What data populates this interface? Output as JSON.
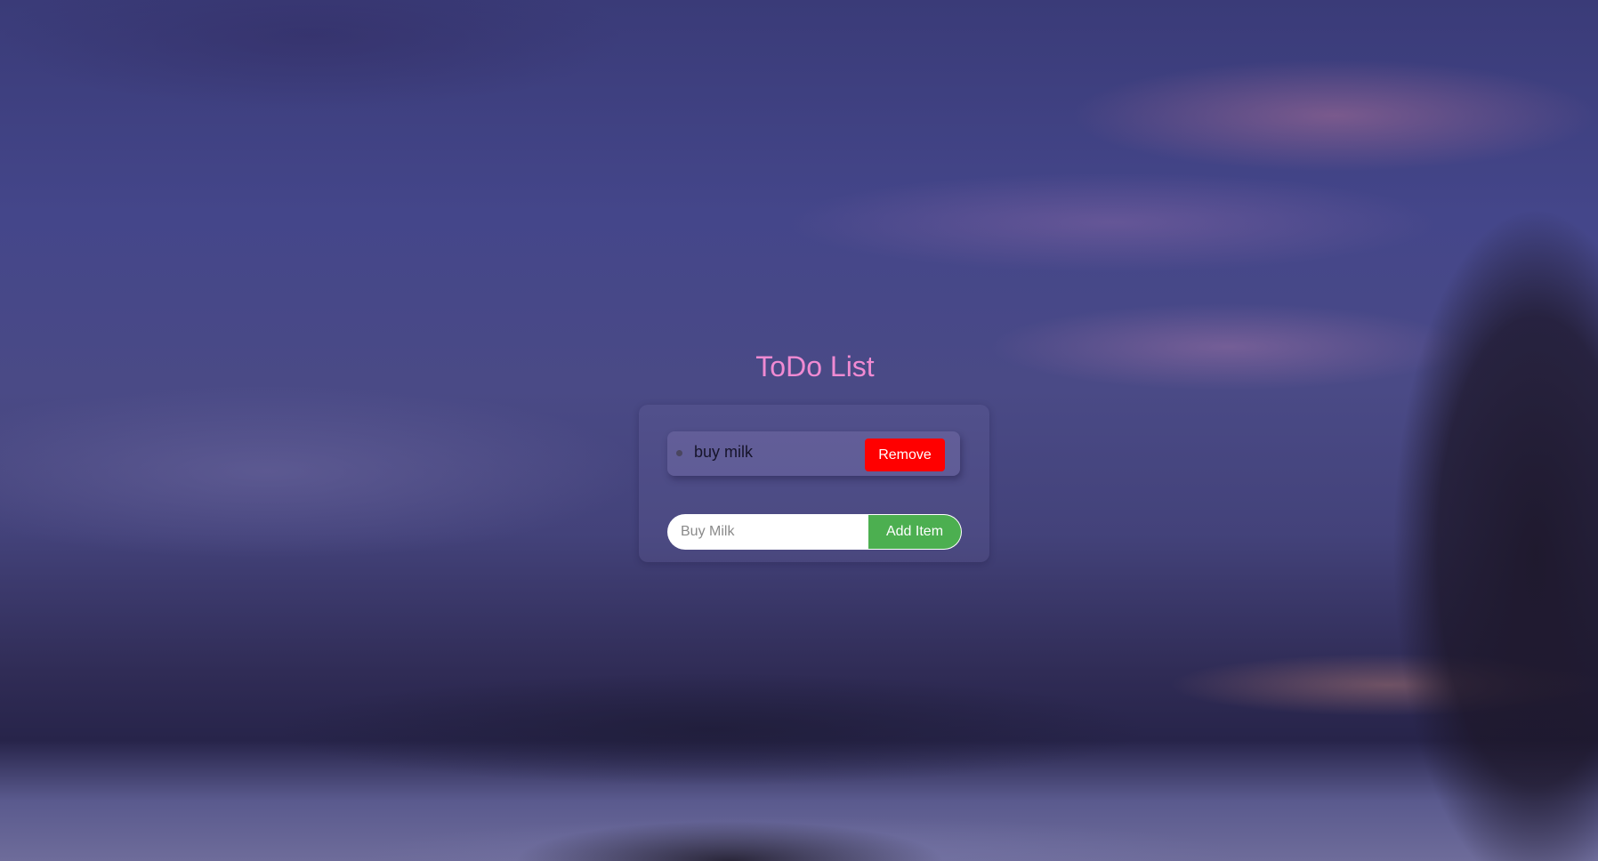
{
  "app": {
    "title": "ToDo List"
  },
  "todo": {
    "items": [
      {
        "text": "buy milk",
        "remove_label": "Remove"
      }
    ]
  },
  "add_form": {
    "placeholder": "Buy Milk",
    "value": "",
    "button_label": "Add Item"
  },
  "colors": {
    "title": "#f08ad2",
    "remove_button": "#ff0000",
    "add_button": "#4caf50"
  }
}
